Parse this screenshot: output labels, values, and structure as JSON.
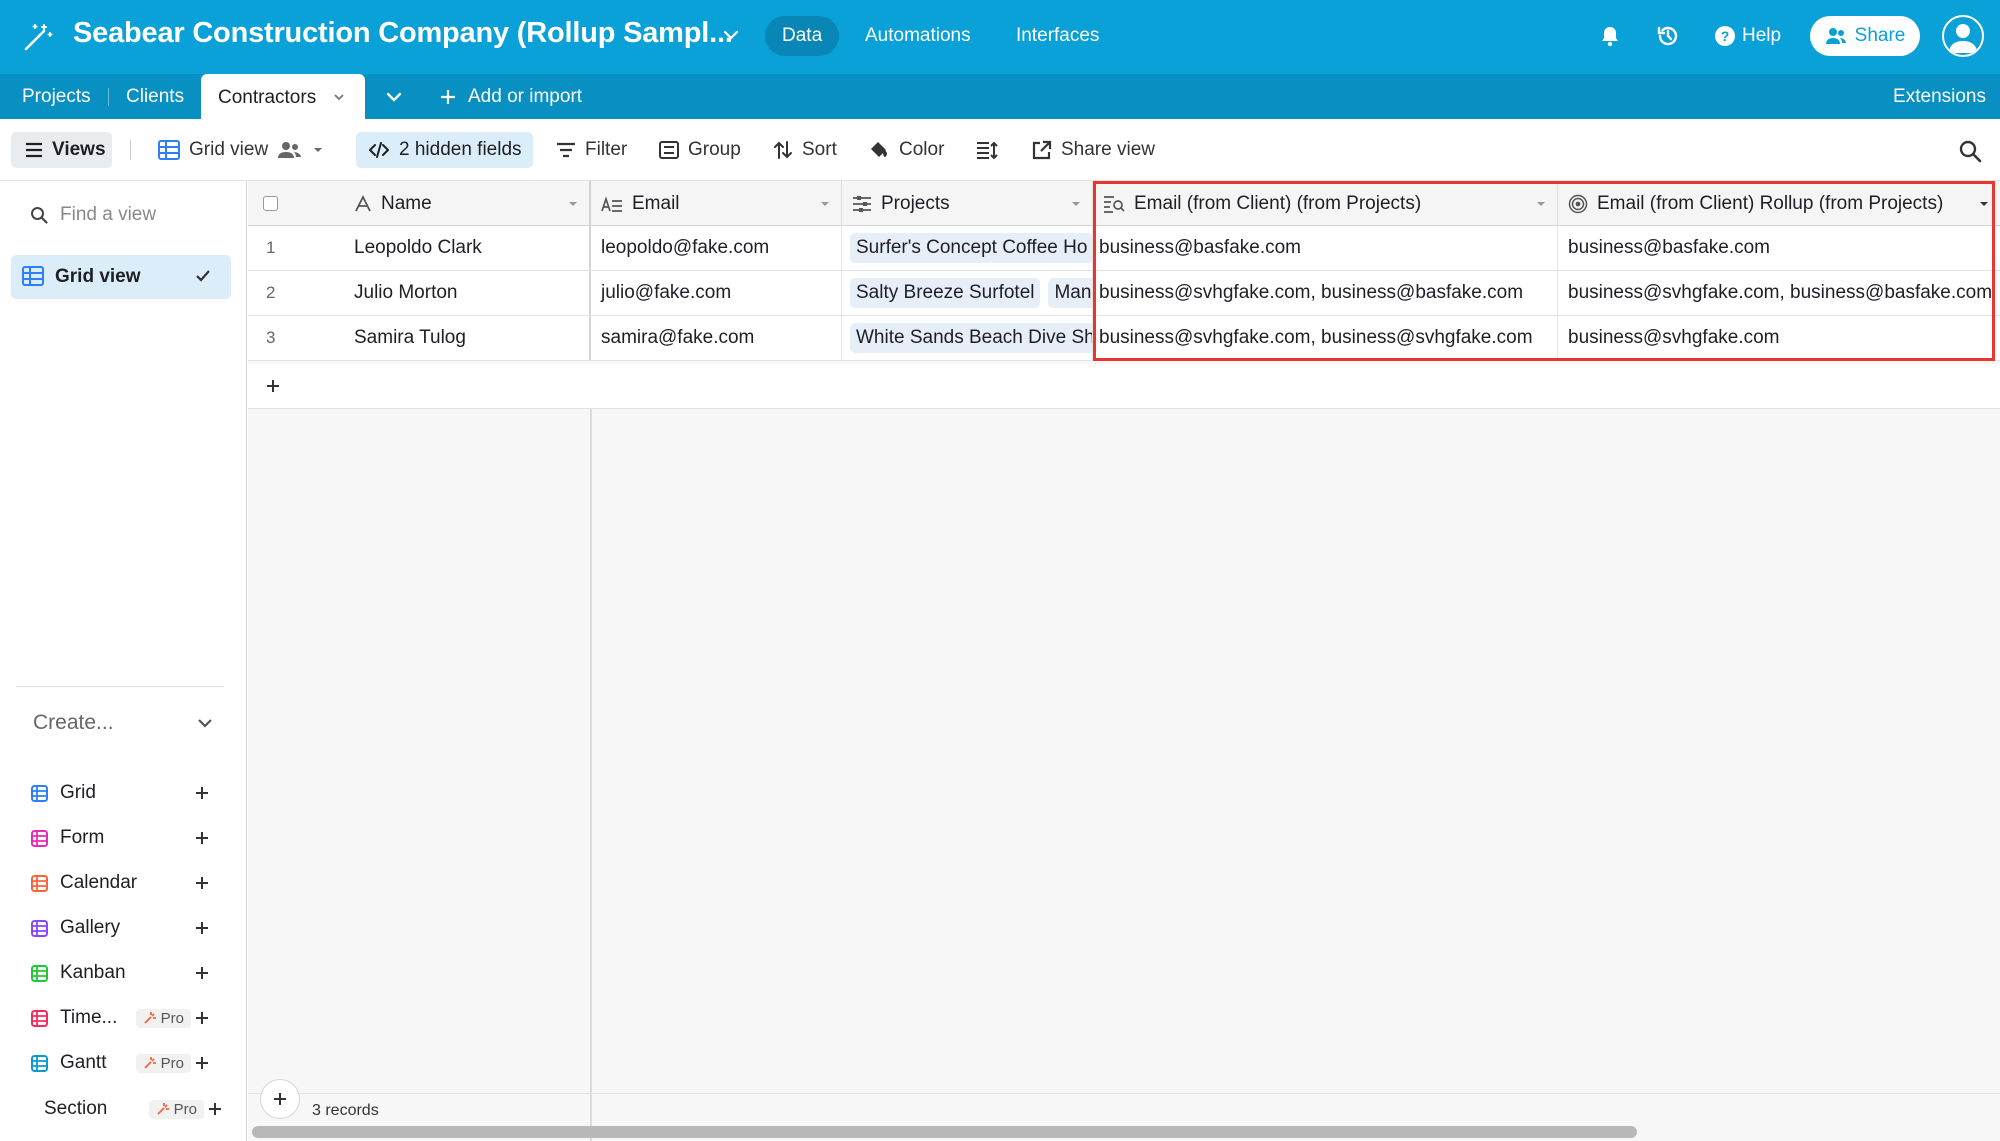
{
  "topbar": {
    "base_title": "Seabear Construction Company (Rollup Sampl...",
    "nav": [
      "Data",
      "Automations",
      "Interfaces"
    ],
    "help_label": "Help",
    "share_label": "Share",
    "bg_color": "#0aa0d8"
  },
  "tabs": {
    "items": [
      "Projects",
      "Clients"
    ],
    "active": "Contractors",
    "add_import": "Add or import",
    "extensions": "Extensions"
  },
  "toolbar": {
    "views": "Views",
    "grid_view": "Grid view",
    "hidden_fields": "2 hidden fields",
    "filter": "Filter",
    "group": "Group",
    "sort": "Sort",
    "color": "Color",
    "share_view": "Share view"
  },
  "sidebar": {
    "find_placeholder": "Find a view",
    "active_view": "Grid view",
    "create_label": "Create...",
    "create_items": [
      {
        "label": "Grid",
        "icon": "grid-icon",
        "color": "#2d7ff9",
        "pro": false
      },
      {
        "label": "Form",
        "icon": "form-icon",
        "color": "#e929ba",
        "pro": false
      },
      {
        "label": "Calendar",
        "icon": "calendar-icon",
        "color": "#f7653b",
        "pro": false
      },
      {
        "label": "Gallery",
        "icon": "gallery-icon",
        "color": "#8b46ff",
        "pro": false
      },
      {
        "label": "Kanban",
        "icon": "kanban-icon",
        "color": "#20c933",
        "pro": false
      },
      {
        "label": "Time...",
        "icon": "timeline-icon",
        "color": "#f82b60",
        "pro": true
      },
      {
        "label": "Gantt",
        "icon": "gantt-icon",
        "color": "#0d9ad0",
        "pro": true
      },
      {
        "label": "Section",
        "icon": "section-icon",
        "color": "#666666",
        "pro": true
      }
    ],
    "pro_label": "Pro"
  },
  "grid": {
    "columns": [
      "Name",
      "Email",
      "Projects",
      "Email (from Client) (from Projects)",
      "Email (from Client) Rollup (from Projects)"
    ],
    "rows": [
      {
        "num": "1",
        "name": "Leopoldo Clark",
        "email": "leopoldo@fake.com",
        "projects": [
          "Surfer's Concept Coffee Ho"
        ],
        "lookup": "business@basfake.com",
        "rollup": "business@basfake.com"
      },
      {
        "num": "2",
        "name": "Julio Morton",
        "email": "julio@fake.com",
        "projects": [
          "Salty Breeze Surfotel",
          "Mana"
        ],
        "lookup": "business@svhgfake.com, business@basfake.com",
        "rollup": "business@svhgfake.com, business@basfake.com"
      },
      {
        "num": "3",
        "name": "Samira Tulog",
        "email": "samira@fake.com",
        "projects": [
          "White Sands Beach Dive Sh"
        ],
        "lookup": "business@svhgfake.com, business@svhgfake.com",
        "rollup": "business@svhgfake.com"
      }
    ],
    "record_count": "3 records",
    "highlight_color": "#e8352d"
  }
}
